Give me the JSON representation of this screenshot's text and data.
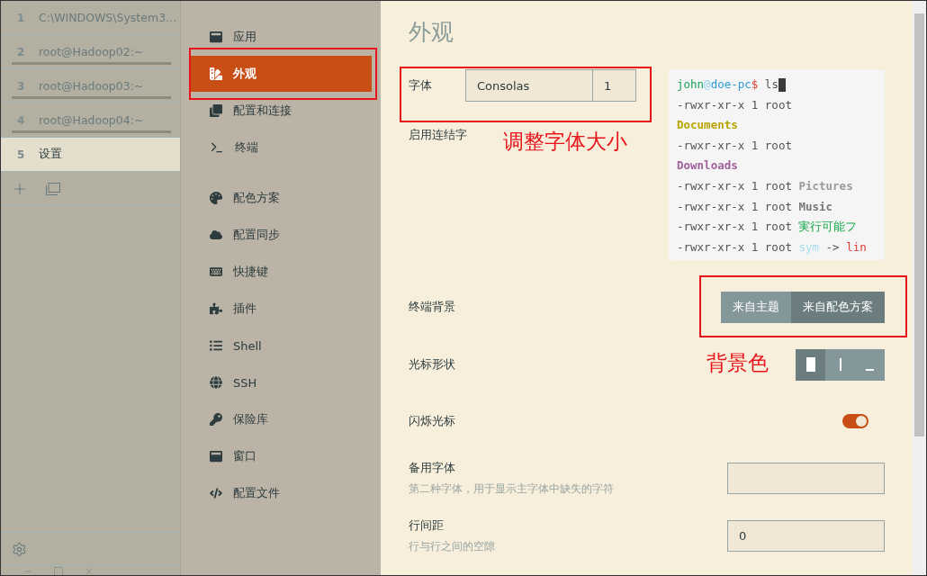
{
  "tabs": [
    {
      "number": "1",
      "title": "C:\\WINDOWS\\System3…",
      "selected": false,
      "underlined": false
    },
    {
      "number": "2",
      "title": "root@Hadoop02:~",
      "selected": false,
      "underlined": true
    },
    {
      "number": "3",
      "title": "root@Hadoop03:~",
      "selected": false,
      "underlined": true
    },
    {
      "number": "4",
      "title": "root@Hadoop04:~",
      "selected": false,
      "underlined": true
    },
    {
      "number": "5",
      "title": "设置",
      "selected": true,
      "underlined": false
    }
  ],
  "nav": {
    "sections": [
      {
        "items": [
          {
            "label": "应用",
            "selected": false
          },
          {
            "label": "外观",
            "selected": true
          },
          {
            "label": "配置和连接",
            "selected": false
          },
          {
            "label": "终端",
            "selected": false
          }
        ]
      },
      {
        "items": [
          {
            "label": "配色方案",
            "selected": false
          },
          {
            "label": "配置同步",
            "selected": false
          },
          {
            "label": "快捷键",
            "selected": false
          },
          {
            "label": "插件",
            "selected": false
          },
          {
            "label": "Shell",
            "selected": false
          },
          {
            "label": "SSH",
            "selected": false
          },
          {
            "label": "保险库",
            "selected": false
          },
          {
            "label": "窗口",
            "selected": false
          },
          {
            "label": "配置文件",
            "selected": false
          }
        ]
      }
    ]
  },
  "page_title": "外观",
  "font": {
    "label": "字体",
    "family": "Consolas",
    "size": "1"
  },
  "ligatures": {
    "label": "启用连结字"
  },
  "preview": {
    "lines": [
      [
        {
          "text": "john",
          "color": "#1aa35c"
        },
        {
          "text": "@",
          "color": "#8fd0e8"
        },
        {
          "text": "doe-pc",
          "color": "#2a9ad6"
        },
        {
          "text": "$",
          "color": "#e03c31"
        },
        {
          "text": " ls",
          "color": "#555555"
        }
      ],
      [
        {
          "text": "-rwxr-xr-x 1 root",
          "color": "#555555"
        }
      ],
      [
        {
          "text": "Documents",
          "color": "#b8a600",
          "bold": true
        }
      ],
      [
        {
          "text": "-rwxr-xr-x 1 root",
          "color": "#555555"
        }
      ],
      [
        {
          "text": "Downloads",
          "color": "#a0609a",
          "bold": true
        }
      ],
      [
        {
          "text": "-rwxr-xr-x 1 root ",
          "color": "#555555"
        },
        {
          "text": "Pictures",
          "color": "#9a9a9a",
          "bold": true
        }
      ],
      [
        {
          "text": "-rwxr-xr-x 1 root ",
          "color": "#555555"
        },
        {
          "text": "Music",
          "color": "#777777",
          "bold": true
        }
      ],
      [
        {
          "text": "-rwxr-xr-x 1 root ",
          "color": "#555555"
        },
        {
          "text": "実行可能フ",
          "color": "#18a84a"
        }
      ],
      [
        {
          "text": "-rwxr-xr-x 1 root ",
          "color": "#555555"
        },
        {
          "text": "sym",
          "color": "#a8dcef"
        },
        {
          "text": " -> ",
          "color": "#555555"
        },
        {
          "text": "lin",
          "color": "#e03c31"
        }
      ]
    ]
  },
  "settings": [
    {
      "kind": "segmented",
      "label": "终端背景",
      "options": [
        {
          "label": "来自主题",
          "selected": false
        },
        {
          "label": "来自配色方案",
          "selected": true
        }
      ]
    },
    {
      "kind": "cursor",
      "label": "光标形状",
      "options": [
        {
          "kind": "block",
          "selected": true
        },
        {
          "kind": "beam",
          "selected": false
        },
        {
          "kind": "underline",
          "selected": false
        }
      ]
    },
    {
      "kind": "toggle",
      "label": "闪烁光标",
      "on": true
    },
    {
      "kind": "input",
      "label": "备用字体",
      "description": "第二种字体，用于显示主字体中缺失的字符"
    },
    {
      "kind": "input",
      "label": "行间距",
      "description": "行与行之间的空隙",
      "value": "0"
    }
  ],
  "annotations": [
    {
      "text": "调整字体大小"
    },
    {
      "text": "背景色"
    }
  ]
}
